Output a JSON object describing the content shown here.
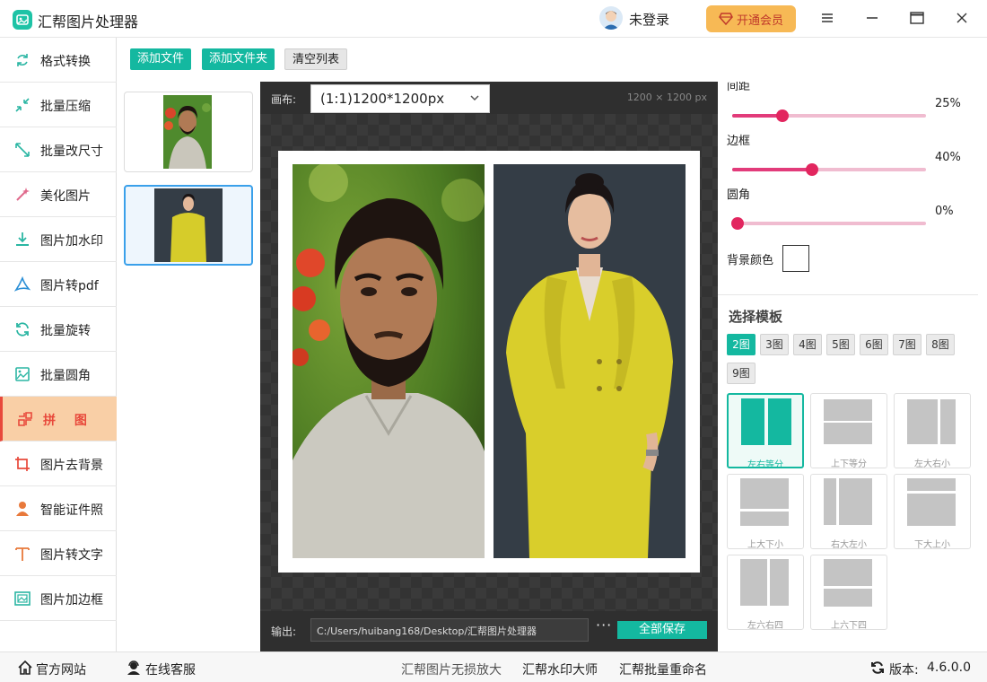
{
  "app": {
    "title": "汇帮图片处理器"
  },
  "header": {
    "user_label": "未登录",
    "vip_label": "开通会员"
  },
  "sidebar": {
    "items": [
      {
        "label": "格式转换",
        "icon": "format-convert-icon"
      },
      {
        "label": "批量压缩",
        "icon": "compress-icon"
      },
      {
        "label": "批量改尺寸",
        "icon": "resize-icon"
      },
      {
        "label": "美化图片",
        "icon": "beautify-icon"
      },
      {
        "label": "图片加水印",
        "icon": "watermark-icon"
      },
      {
        "label": "图片转pdf",
        "icon": "pdf-icon"
      },
      {
        "label": "批量旋转",
        "icon": "rotate-icon"
      },
      {
        "label": "批量圆角",
        "icon": "round-corner-icon"
      },
      {
        "label": "拼 图",
        "icon": "collage-icon",
        "active": true
      },
      {
        "label": "图片去背景",
        "icon": "crop-icon"
      },
      {
        "label": "智能证件照",
        "icon": "person-icon"
      },
      {
        "label": "图片转文字",
        "icon": "text-icon"
      },
      {
        "label": "图片加边框",
        "icon": "frame-icon"
      }
    ]
  },
  "toolbar": {
    "add_file": "添加文件",
    "add_folder": "添加文件夹",
    "clear_list": "清空列表"
  },
  "canvas": {
    "label": "画布:",
    "size_value": "(1:1)1200*1200px",
    "dims": "1200 × 1200 px",
    "output_label": "输出:",
    "output_path": "C:/Users/huibang168/Desktop/汇帮图片处理器",
    "more": "···",
    "save_all": "全部保存"
  },
  "settings": {
    "spacing": {
      "label": "间距",
      "value": "25%",
      "level": 0.26
    },
    "border": {
      "label": "边框",
      "value": "40%",
      "level": 0.41
    },
    "radius": {
      "label": "圆角",
      "value": "0%",
      "level": 0.03
    },
    "bg_color": {
      "label": "背景颜色",
      "color": "#ffffff"
    }
  },
  "templates": {
    "title": "选择模板",
    "counts": [
      "2图",
      "3图",
      "4图",
      "5图",
      "6图",
      "7图",
      "8图",
      "9图"
    ],
    "active_count": "2图",
    "cards": [
      "左右等分",
      "上下等分",
      "左大右小",
      "上大下小",
      "右大左小",
      "下大上小",
      "左六右四",
      "上六下四"
    ],
    "active_card": "左右等分"
  },
  "footer": {
    "website": "官方网站",
    "support": "在线客服",
    "promo1": "汇帮图片无损放大",
    "promo2": "汇帮水印大师",
    "promo3": "汇帮批量重命名",
    "version_label": "版本:",
    "version": "4.6.0.0"
  },
  "colors": {
    "accent": "#14b8a0",
    "active_bg": "#f9cfa6",
    "active_text": "#e8493b",
    "slider": "#e2265f",
    "vip": "#f7b955"
  }
}
